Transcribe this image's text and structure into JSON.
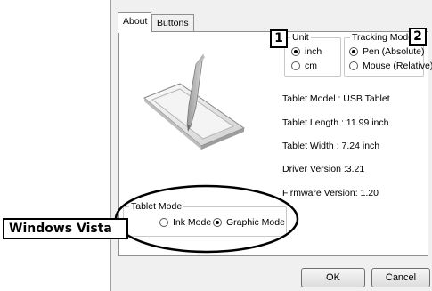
{
  "tabs": [
    {
      "label": "About"
    },
    {
      "label": "Buttons"
    }
  ],
  "unit": {
    "title": "Unit",
    "options": [
      {
        "label": "inch",
        "checked": true
      },
      {
        "label": "cm",
        "checked": false
      }
    ]
  },
  "tracking_mode": {
    "title": "Tracking Mode",
    "options": [
      {
        "label": "Pen (Absolute)",
        "checked": true
      },
      {
        "label": "Mouse (Relative)",
        "checked": false
      }
    ]
  },
  "info": {
    "model": "Tablet Model : USB Tablet",
    "length": "Tablet Length : 11.99 inch",
    "width": "Tablet Width : 7.24 inch",
    "driver": "Driver Version :3.21",
    "firmware": "Firmware Version: 1.20"
  },
  "tablet_mode": {
    "title": "Tablet Mode",
    "options": [
      {
        "label": "Ink Mode",
        "checked": false
      },
      {
        "label": "Graphic Mode",
        "checked": true
      }
    ]
  },
  "buttons": {
    "ok": "OK",
    "cancel": "Cancel"
  },
  "annotations": {
    "badge1": "1",
    "badge2": "2",
    "windows_vista": "Windows Vista"
  }
}
